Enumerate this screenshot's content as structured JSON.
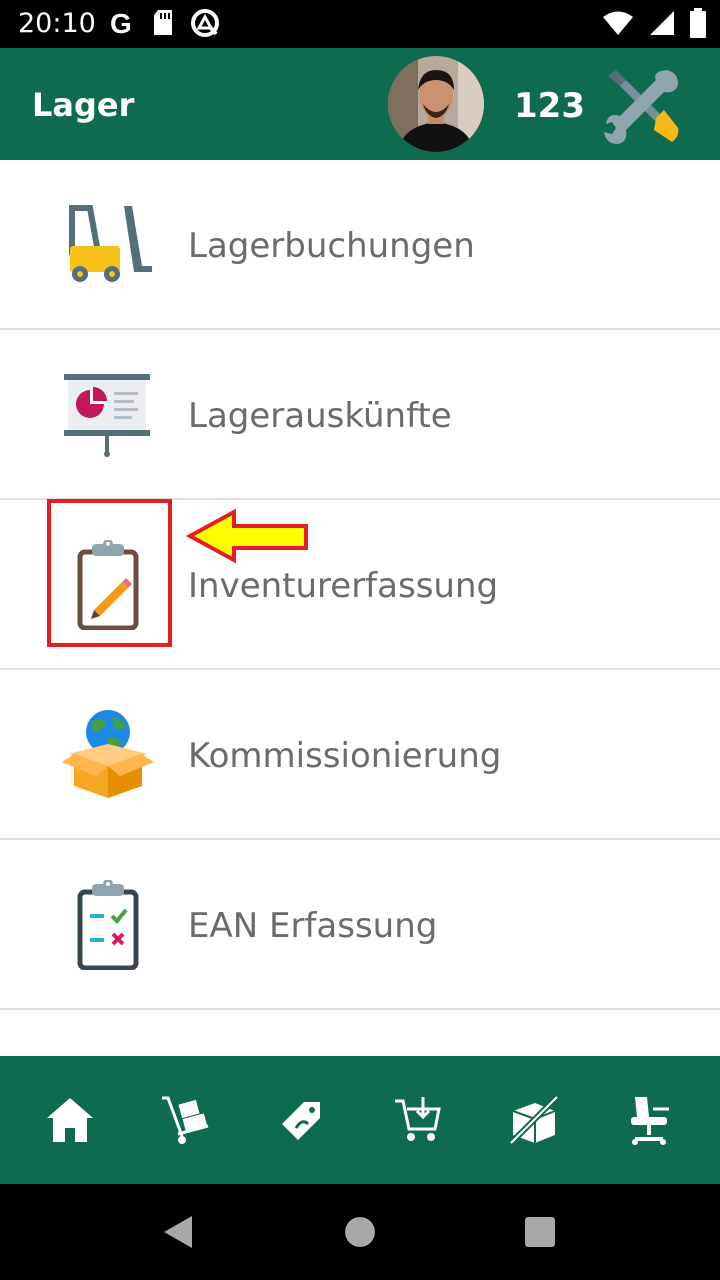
{
  "status_bar": {
    "time": "20:10",
    "left_icons": [
      "google-icon",
      "sd-card-icon",
      "data-saver-icon"
    ],
    "right_icons": [
      "wifi-icon",
      "signal-icon",
      "battery-icon"
    ]
  },
  "app_bar": {
    "title": "Lager",
    "user_number": "123",
    "avatar_icon": "user-avatar",
    "tools_icon": "tools-icon"
  },
  "menu": {
    "items": [
      {
        "label": "Lagerbuchungen",
        "icon": "forklift-icon"
      },
      {
        "label": "Lagerauskünfte",
        "icon": "presentation-chart-icon"
      },
      {
        "label": "Inventurerfassung",
        "icon": "clipboard-pencil-icon"
      },
      {
        "label": "Kommissionierung",
        "icon": "globe-box-icon"
      },
      {
        "label": "EAN Erfassung",
        "icon": "clipboard-checklist-icon"
      }
    ]
  },
  "annotation": {
    "highlighted_item": "Inventurerfassung",
    "highlight_color": "#e31e24",
    "arrow_color": "#ffff00"
  },
  "bottom_nav": {
    "items": [
      "home-icon",
      "hand-truck-icon",
      "price-tag-icon",
      "cart-download-icon",
      "box-crossed-icon",
      "office-chair-icon"
    ]
  },
  "colors": {
    "brand_green": "#0e6b50",
    "label_gray": "#6b6b6b"
  }
}
